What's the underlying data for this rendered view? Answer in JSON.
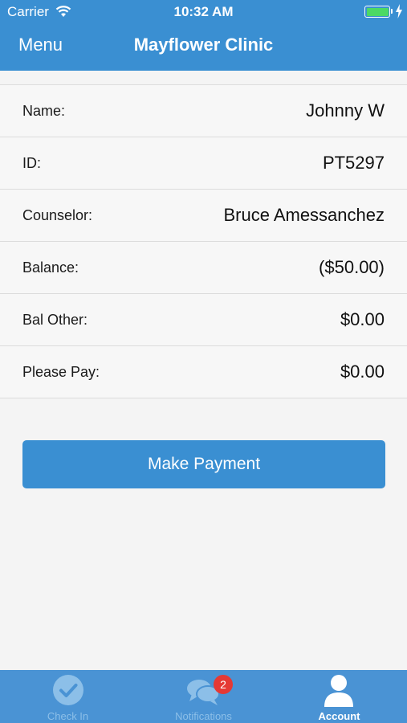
{
  "status_bar": {
    "carrier": "Carrier",
    "time": "10:32 AM",
    "battery_level": 1.0
  },
  "nav": {
    "menu_label": "Menu",
    "title": "Mayflower Clinic"
  },
  "patient_info": [
    {
      "label": "Name:",
      "value": "Johnny W"
    },
    {
      "label": "ID:",
      "value": "PT5297"
    },
    {
      "label": "Counselor:",
      "value": "Bruce Amessanchez"
    },
    {
      "label": "Balance:",
      "value": "($50.00)"
    },
    {
      "label": "Bal Other:",
      "value": "$0.00"
    },
    {
      "label": "Please Pay:",
      "value": "$0.00"
    }
  ],
  "payment": {
    "button_label": "Make Payment"
  },
  "tab_bar": {
    "tabs": [
      {
        "label": "Check In",
        "icon": "check-circle-icon",
        "active": false
      },
      {
        "label": "Notifications",
        "icon": "chat-bubbles-icon",
        "active": false,
        "badge": "2"
      },
      {
        "label": "Account",
        "icon": "user-icon",
        "active": true
      }
    ]
  },
  "colors": {
    "primary": "#3a8fd2",
    "tab_bar": "#4a93d4",
    "badge": "#e53935",
    "background": "#f4f4f4"
  }
}
